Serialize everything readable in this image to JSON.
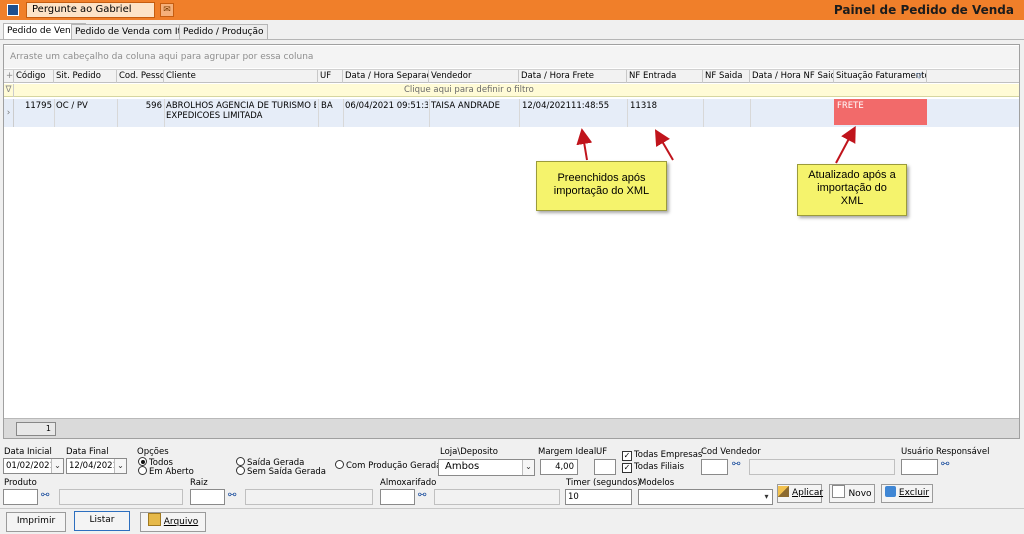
{
  "titlebar": {
    "ask_label": "Pergunte ao Gabriel",
    "panel_title": "Painel de Pedido de Venda"
  },
  "tabs": [
    {
      "label": "Pedido de Venda",
      "active": true
    },
    {
      "label": "Pedido de Venda com Itens",
      "active": false
    },
    {
      "label": "Pedido / Produção",
      "active": false
    }
  ],
  "grid": {
    "group_hint": "Arraste um cabeçalho da coluna aqui para agrupar por essa coluna",
    "filter_hint": "Clique aqui para definir o filtro",
    "columns": [
      "Código",
      "Sit. Pedido",
      "Cod. Pessoa",
      "Cliente",
      "UF",
      "Data / Hora Separação",
      "Vendedor",
      "Data / Hora Frete",
      "NF Entrada",
      "NF Saida",
      "Data / Hora NF Saida",
      "Situação Faturamento"
    ],
    "row": {
      "codigo": "11795",
      "sit_pedido": "OC / PV",
      "cod_pessoa": "596",
      "cliente_line1": "ABROLHOS AGENCIA DE TURISMO E",
      "cliente_line2": "EXPEDICOES LIMITADA",
      "uf": "BA",
      "data_separacao": "06/04/2021 09:51:36",
      "vendedor": "TAISA ANDRADE",
      "data_frete": "12/04/202111:48:55",
      "nf_entrada": "11318",
      "nf_saida": "",
      "data_nf_saida": "",
      "situacao_faturamento": "FRETE"
    },
    "record_count": "1"
  },
  "annotations": {
    "note1_line1": "Preenchidos após",
    "note1_line2": "importação do XML",
    "note2_line1": "Atualizado após a",
    "note2_line2": "importação do",
    "note2_line3": "XML"
  },
  "filters": {
    "data_inicial_label": "Data Inicial",
    "data_inicial": "01/02/2021",
    "data_final_label": "Data Final",
    "data_final": "12/04/2021",
    "opcoes_label": "Opções",
    "opt_todos": "Todos",
    "opt_em_aberto": "Em Aberto",
    "opt_saida_gerada": "Saída Gerada",
    "opt_sem_saida": "Sem Saída Gerada",
    "opt_com_producao": "Com Produção Gerada",
    "loja_label": "Loja\\Deposito",
    "loja_value": "Ambos",
    "margem_label": "Margem Ideal",
    "margem_value": "4,00",
    "uf_label": "UF",
    "todas_empresas": "Todas Empresas",
    "todas_filiais": "Todas Filiais",
    "cod_vendedor_label": "Cod Vendedor",
    "usuario_label": "Usuário Responsável",
    "produto_label": "Produto",
    "raiz_label": "Raiz",
    "almoxarifado_label": "Almoxarifado",
    "timer_label": "Timer (segundos)",
    "timer_value": "10",
    "modelos_label": "Modelos"
  },
  "buttons": {
    "aplicar": "Aplicar",
    "novo": "Novo",
    "excluir": "Excluir",
    "imprimir": "Imprimir",
    "listar": "Listar",
    "arquivo": "Arquivo"
  },
  "colors": {
    "titlebar": "#f07f2a",
    "faturamento_highlight": "#f26a6a",
    "note_yellow": "#f5f36c",
    "arrow_red": "#c0141c"
  }
}
